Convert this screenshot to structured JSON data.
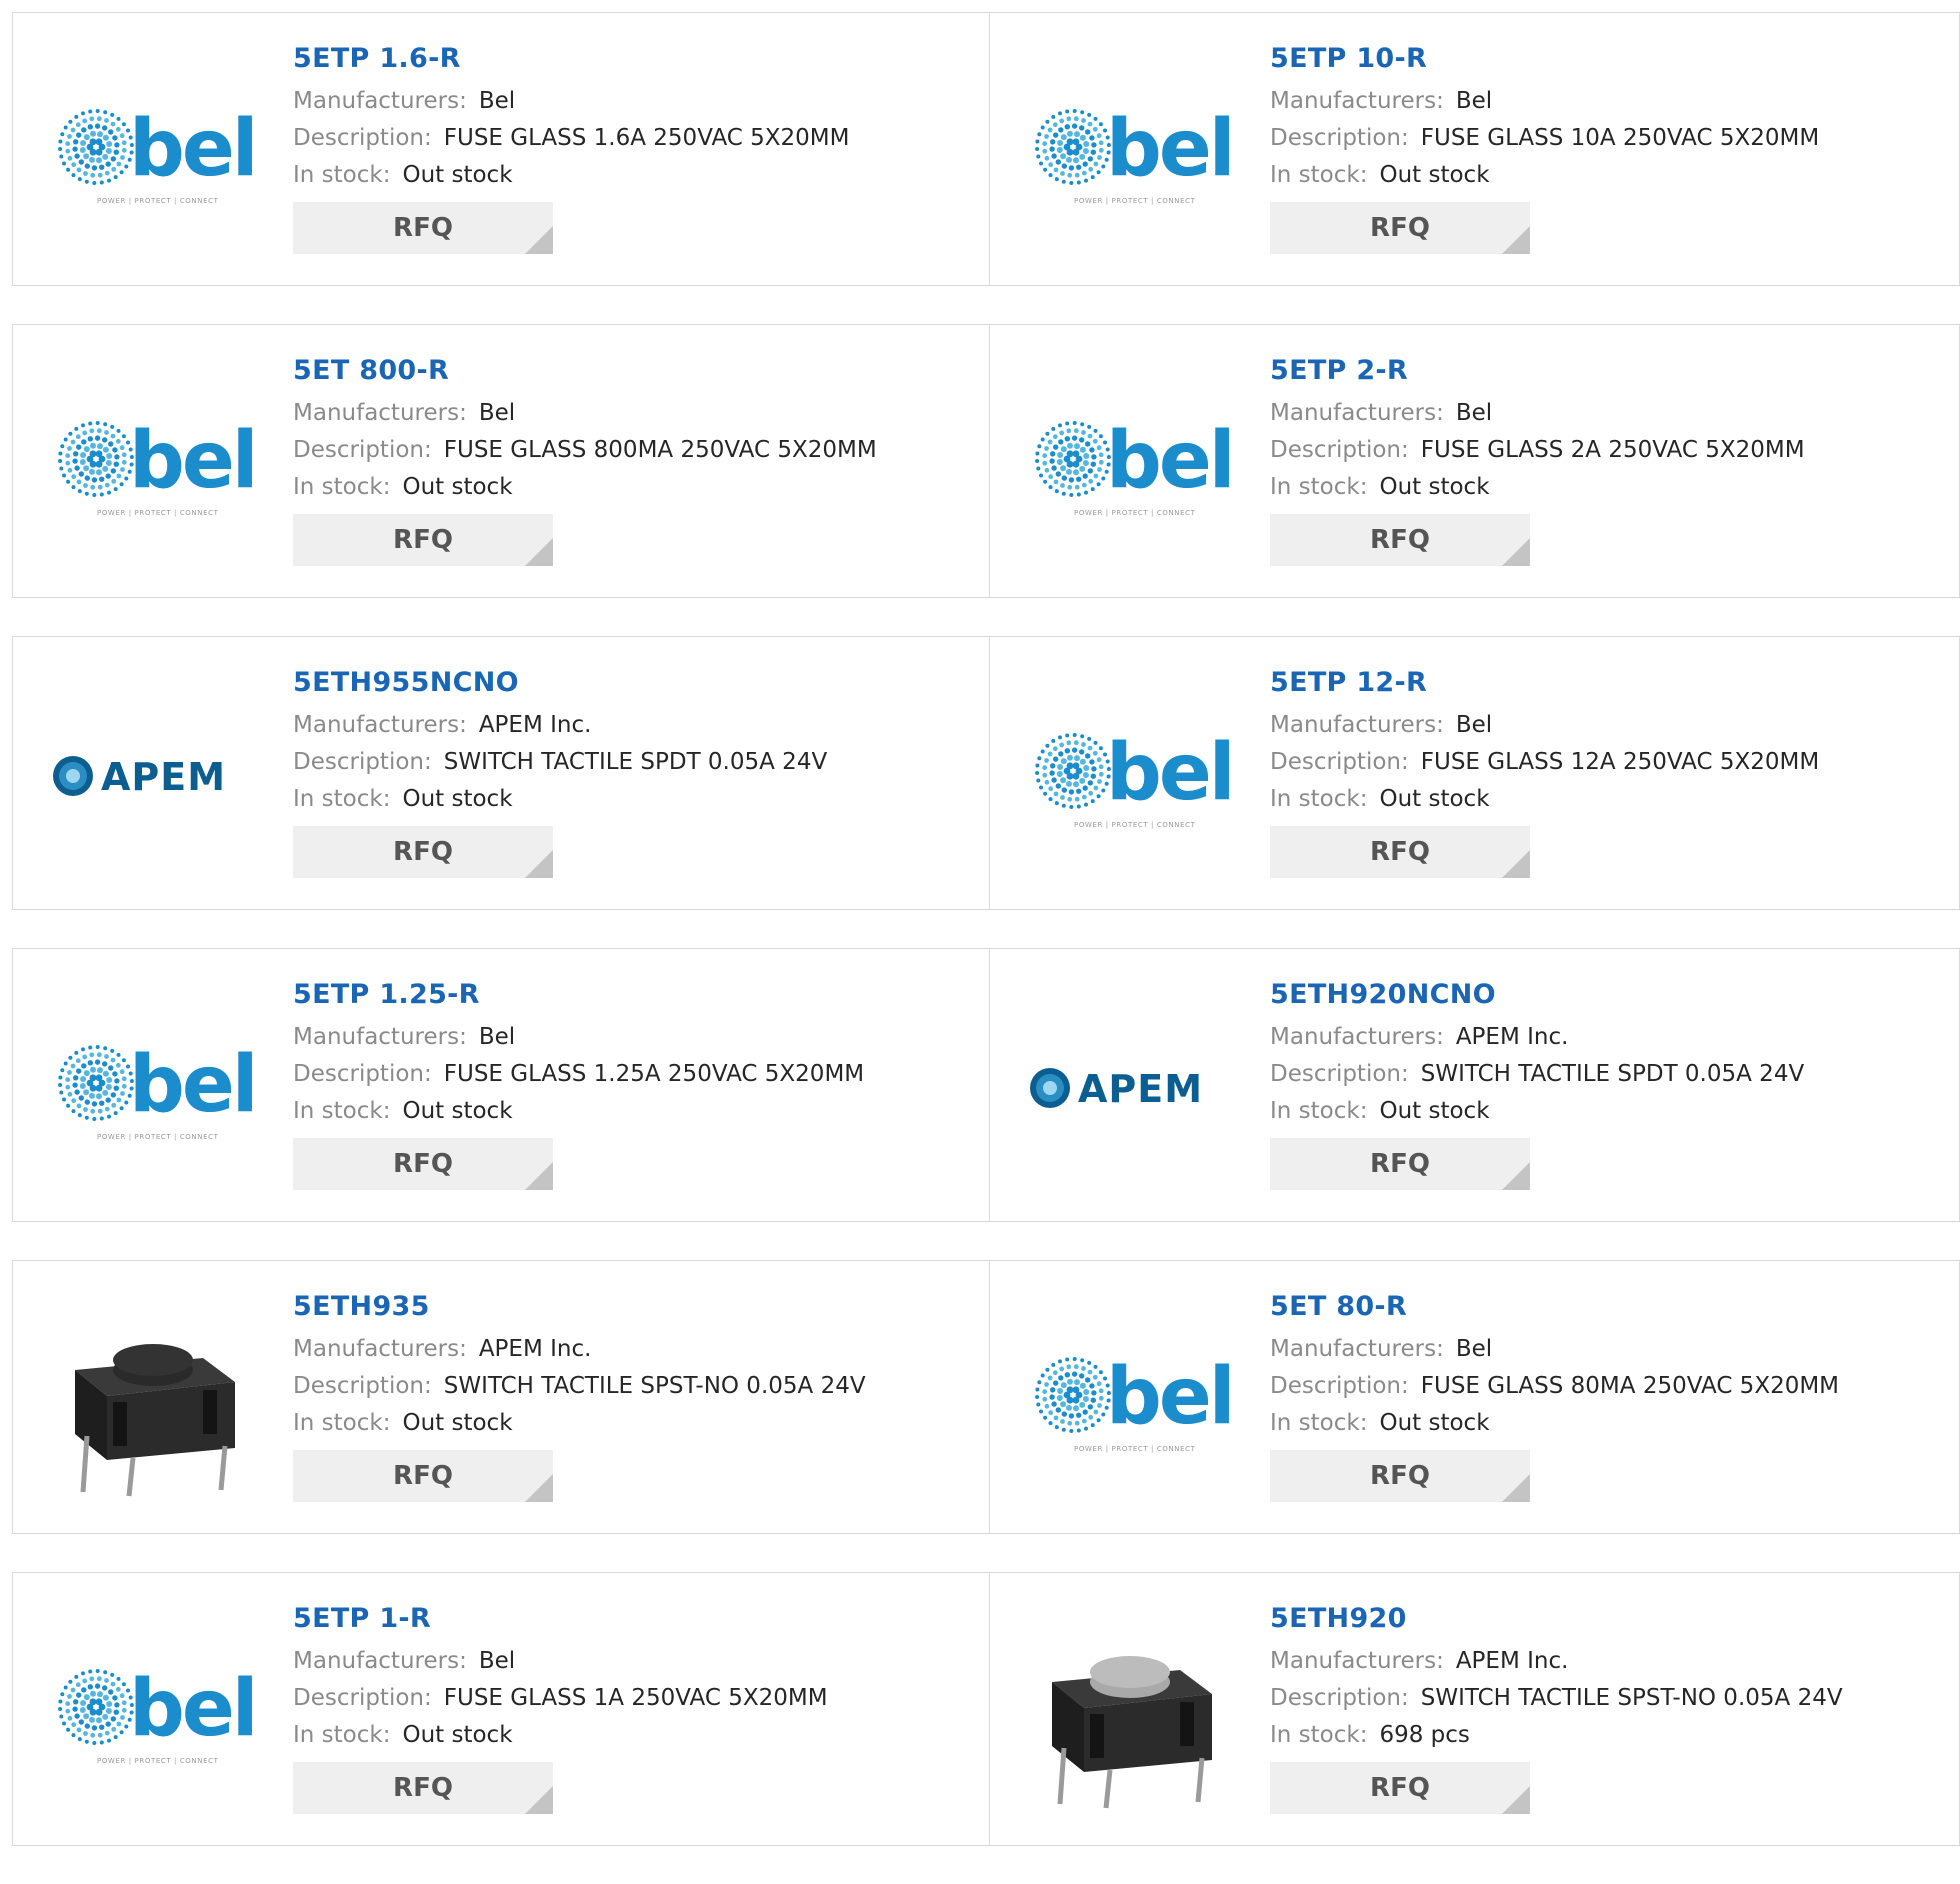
{
  "labels": {
    "manufacturers": "Manufacturers:",
    "description": "Description:",
    "stock": "In stock:",
    "rfq": "RFQ"
  },
  "colors": {
    "part_link": "#1a66b5",
    "bel_blue": "#1b8ccc",
    "apem_blue": "#0b5e8f",
    "rfq_bg": "#efefef"
  },
  "rows": [
    [
      {
        "part": "5ETP 1.6-R",
        "manufacturer": "Bel",
        "description": "FUSE GLASS 1.6A 250VAC 5X20MM",
        "stock": "Out stock",
        "image": "bel-logo",
        "bel_tagline": "POWER | PROTECT | CONNECT"
      },
      {
        "part": "5ETP 10-R",
        "manufacturer": "Bel",
        "description": "FUSE GLASS 10A 250VAC 5X20MM",
        "stock": "Out stock",
        "image": "bel-logo",
        "bel_tagline": "POWER | PROTECT | CONNECT"
      }
    ],
    [
      {
        "part": "5ET 800-R",
        "manufacturer": "Bel",
        "description": "FUSE GLASS 800MA 250VAC 5X20MM",
        "stock": "Out stock",
        "image": "bel-logo",
        "bel_tagline": "POWER | PROTECT | CONNECT"
      },
      {
        "part": "5ETP 2-R",
        "manufacturer": "Bel",
        "description": "FUSE GLASS 2A 250VAC 5X20MM",
        "stock": "Out stock",
        "image": "bel-logo",
        "bel_tagline": "POWER | PROTECT | CONNECT"
      }
    ],
    [
      {
        "part": "5ETH955NCNO",
        "manufacturer": "APEM Inc.",
        "description": "SWITCH TACTILE SPDT 0.05A 24V",
        "stock": "Out stock",
        "image": "apem-logo"
      },
      {
        "part": "5ETP 12-R",
        "manufacturer": "Bel",
        "description": "FUSE GLASS 12A 250VAC 5X20MM",
        "stock": "Out stock",
        "image": "bel-logo",
        "bel_tagline": "POWER | PROTECT | CONNECT"
      }
    ],
    [
      {
        "part": "5ETP 1.25-R",
        "manufacturer": "Bel",
        "description": "FUSE GLASS 1.25A 250VAC 5X20MM",
        "stock": "Out stock",
        "image": "bel-logo",
        "bel_tagline": "POWER | PROTECT | CONNECT"
      },
      {
        "part": "5ETH920NCNO",
        "manufacturer": "APEM Inc.",
        "description": "SWITCH TACTILE SPDT 0.05A 24V",
        "stock": "Out stock",
        "image": "apem-logo"
      }
    ],
    [
      {
        "part": "5ETH935",
        "manufacturer": "APEM Inc.",
        "description": "SWITCH TACTILE SPST-NO 0.05A 24V",
        "stock": "Out stock",
        "image": "tactile-switch-black"
      },
      {
        "part": "5ET 80-R",
        "manufacturer": "Bel",
        "description": "FUSE GLASS 80MA 250VAC 5X20MM",
        "stock": "Out stock",
        "image": "bel-logo",
        "bel_tagline": "POWER | PROTECT | CONNECT"
      }
    ],
    [
      {
        "part": "5ETP 1-R",
        "manufacturer": "Bel",
        "description": "FUSE GLASS 1A 250VAC 5X20MM",
        "stock": "Out stock",
        "image": "bel-logo",
        "bel_tagline": "POWER | PROTECT | CONNECT"
      },
      {
        "part": "5ETH920",
        "manufacturer": "APEM Inc.",
        "description": "SWITCH TACTILE SPST-NO 0.05A 24V",
        "stock": "698 pcs",
        "image": "tactile-switch-grey"
      }
    ]
  ]
}
